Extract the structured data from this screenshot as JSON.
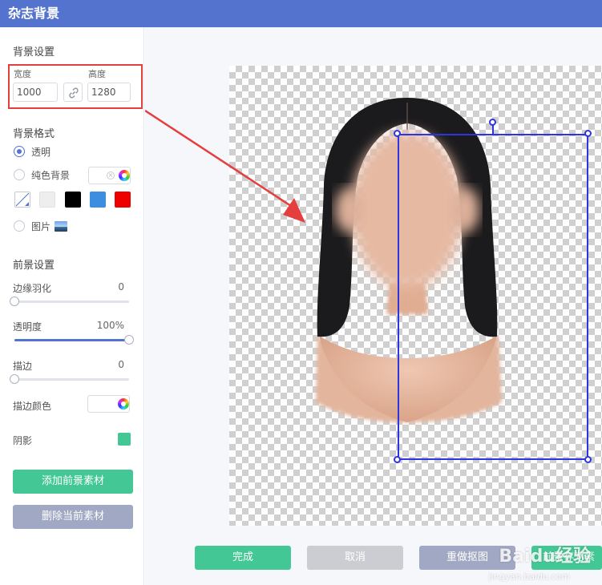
{
  "window": {
    "title": "杂志背景"
  },
  "background_settings": {
    "title": "背景设置",
    "width_label": "宽度",
    "height_label": "高度",
    "width_value": "1000",
    "height_value": "1280",
    "link_icon": "link-icon"
  },
  "background_format": {
    "title": "背景格式",
    "options": [
      {
        "label": "透明",
        "checked": true
      },
      {
        "label": "纯色背景",
        "checked": false
      },
      {
        "label": "图片",
        "checked": false
      }
    ],
    "swatches": [
      "transparent",
      "#eeeeee",
      "#000000",
      "#3b8ee0",
      "#ee0000"
    ]
  },
  "foreground_settings": {
    "title": "前景设置",
    "feather": {
      "label": "边缘羽化",
      "value": "0",
      "fraction": 0
    },
    "opacity": {
      "label": "透明度",
      "value": "100%",
      "fraction": 1
    },
    "stroke": {
      "label": "描边",
      "value": "0",
      "fraction": 0
    },
    "stroke_color_label": "描边颜色",
    "shadow": {
      "label": "阴影",
      "color": "#43c895"
    }
  },
  "actions": {
    "add_foreground": "添加前景素材",
    "delete_current": "删除当前素材"
  },
  "footer": {
    "done": "完成",
    "cancel": "取消",
    "recrop": "重做抠图",
    "save_foreground": "前景存为素"
  },
  "watermark": {
    "brand": "Baidu经验",
    "url": "jingyan.baidu.com"
  },
  "colors": {
    "accent": "#5473cf",
    "green": "#43c895",
    "selection": "#2d35e0",
    "arrow": "#e53e3e"
  }
}
